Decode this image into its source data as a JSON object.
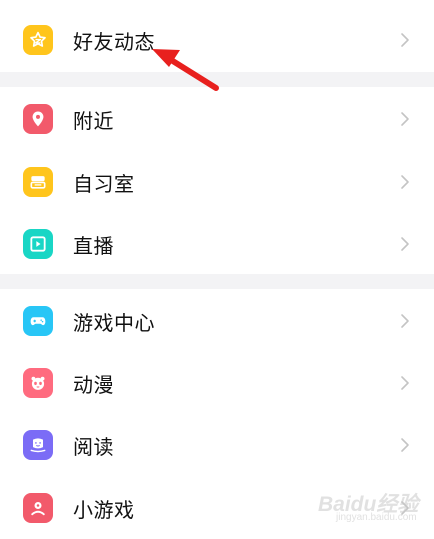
{
  "groups": [
    {
      "items": [
        {
          "label": "好友动态",
          "icon": "star-icon",
          "color": "#FFC51C"
        }
      ]
    },
    {
      "items": [
        {
          "label": "附近",
          "icon": "location-pin-icon",
          "color": "#F25A6B"
        },
        {
          "label": "自习室",
          "icon": "study-room-icon",
          "color": "#FFC51C"
        },
        {
          "label": "直播",
          "icon": "live-icon",
          "color": "#19D6C5"
        }
      ]
    },
    {
      "items": [
        {
          "label": "游戏中心",
          "icon": "gamepad-icon",
          "color": "#28C6F6"
        },
        {
          "label": "动漫",
          "icon": "panda-icon",
          "color": "#FF6B7F"
        },
        {
          "label": "阅读",
          "icon": "reading-icon",
          "color": "#7B6CF6"
        },
        {
          "label": "小游戏",
          "icon": "mini-game-icon",
          "color": "#F25A6B"
        }
      ]
    }
  ],
  "colors": {
    "separator": "#f3f3f5",
    "chevron": "#c4c4c4",
    "annotation_arrow": "#E8201E"
  },
  "watermark": {
    "brand": "Baidu经验",
    "url": "jingyan.baidu.com"
  }
}
